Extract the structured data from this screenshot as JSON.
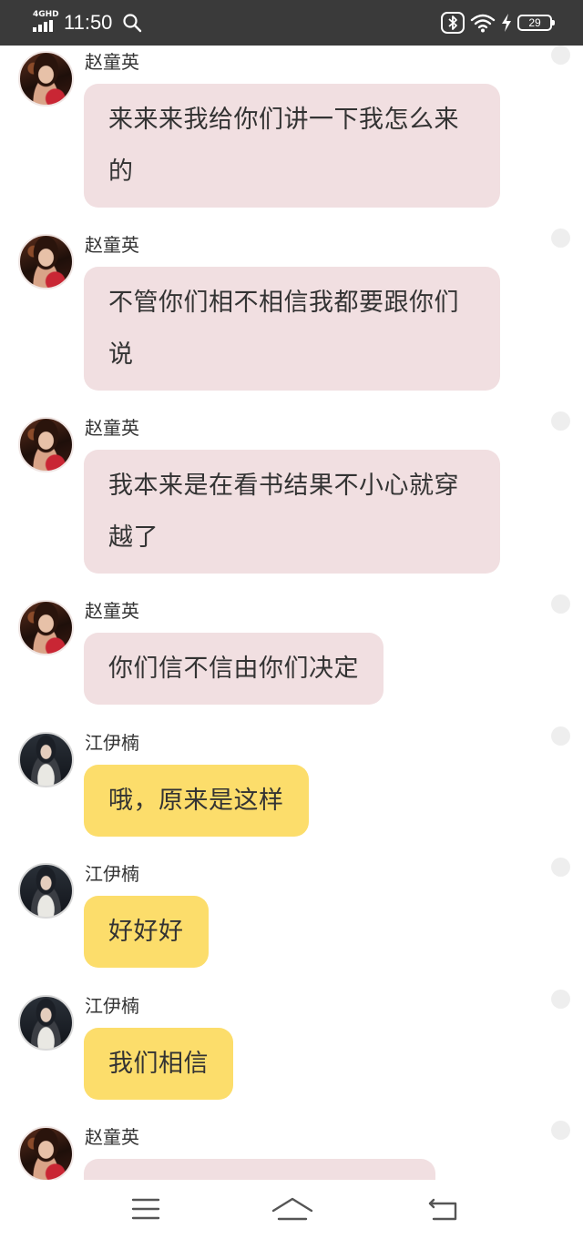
{
  "status_bar": {
    "network": "4GHD",
    "time": "11:50",
    "battery": "29"
  },
  "messages": [
    {
      "sender": "赵童英",
      "avatar": "zhao",
      "text": "来来来我给你们讲一下我怎么来的",
      "color": "#f1dfe1"
    },
    {
      "sender": "赵童英",
      "avatar": "zhao",
      "text": "不管你们相不相信我都要跟你们说",
      "color": "#f1dfe1"
    },
    {
      "sender": "赵童英",
      "avatar": "zhao",
      "text": "我本来是在看书结果不小心就穿越了",
      "color": "#f1dfe1"
    },
    {
      "sender": "赵童英",
      "avatar": "zhao",
      "text": "你们信不信由你们决定",
      "color": "#f1dfe1"
    },
    {
      "sender": "江伊楠",
      "avatar": "jiang",
      "text": "哦，原来是这样",
      "color": "#fcdd6b"
    },
    {
      "sender": "江伊楠",
      "avatar": "jiang",
      "text": "好好好",
      "color": "#fcdd6b"
    },
    {
      "sender": "江伊楠",
      "avatar": "jiang",
      "text": "我们相信",
      "color": "#fcdd6b"
    },
    {
      "sender": "赵童英",
      "avatar": "zhao",
      "text": "",
      "color": "#f1dfe1"
    }
  ],
  "nav_bar": {
    "icons": [
      "menu-icon",
      "home-icon",
      "back-icon"
    ]
  }
}
